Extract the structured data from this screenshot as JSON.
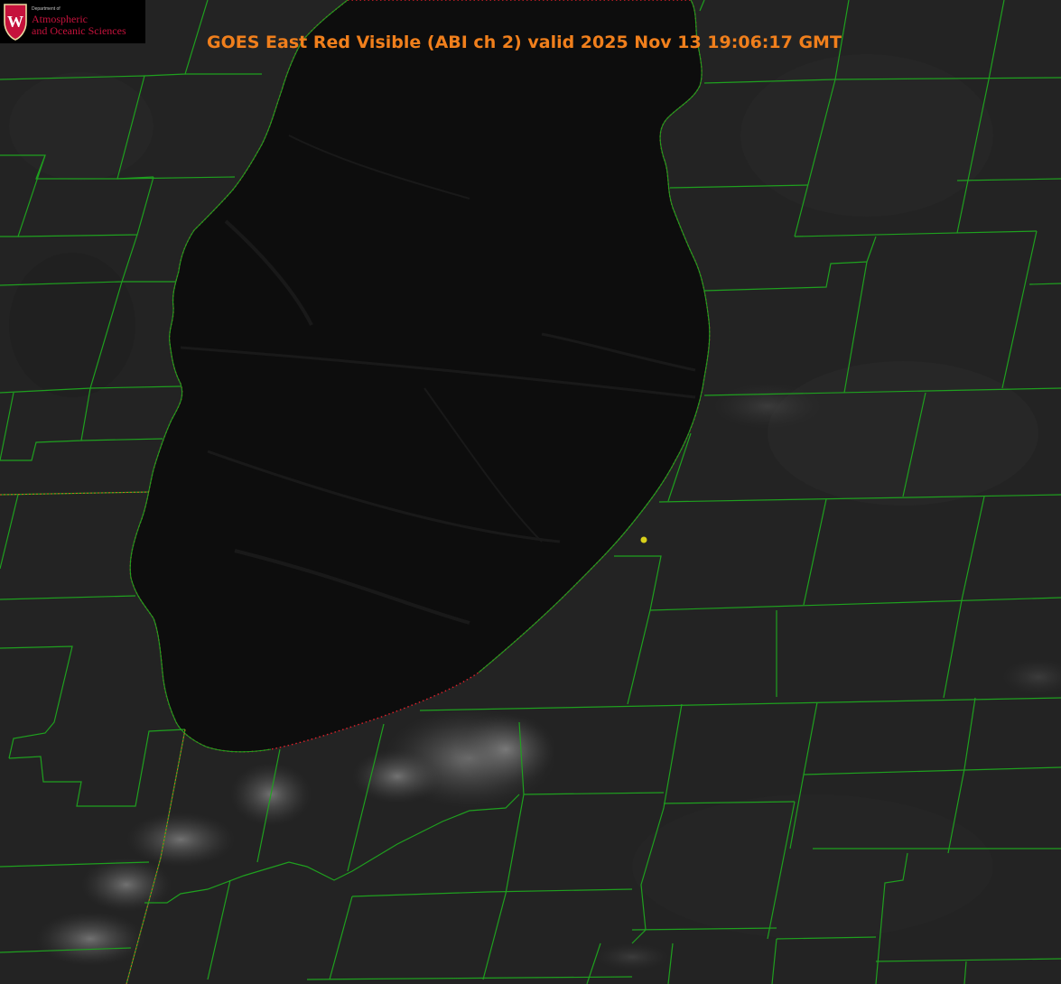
{
  "title": "GOES East Red Visible (ABI ch 2) valid 2025 Nov 13 19:06:17 GMT",
  "logo": {
    "department": "Department of",
    "line1": "Atmospheric",
    "line2": "and Oceanic Sciences",
    "crest_letter": "W"
  },
  "colors": {
    "title": "#f07f1c",
    "county_lines": "#1fa01f",
    "shoreline": "#e0202a",
    "station_marker": "#d8d01a",
    "lake": "#0d0d0d",
    "land": "#232323",
    "logo_red": "#c5123c"
  },
  "map": {
    "feature": "lake",
    "overlay": "county-boundaries",
    "marker": "station-point"
  }
}
